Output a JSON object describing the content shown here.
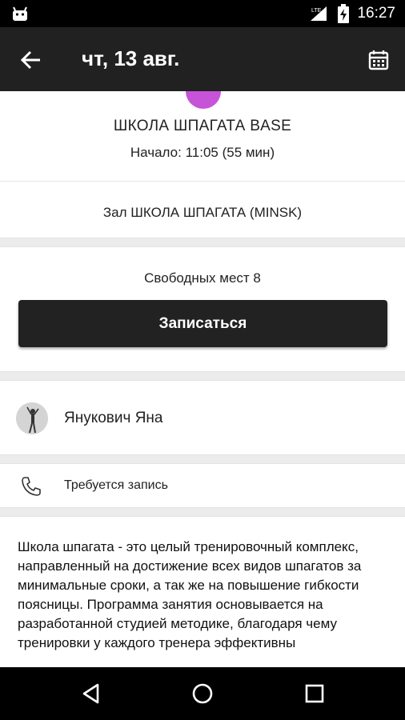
{
  "status_bar": {
    "time": "16:27",
    "network_label": "LTE",
    "icons": [
      "android-icon",
      "signal-icon",
      "battery-charging-icon"
    ]
  },
  "appbar": {
    "title": "чт, 13 авг.",
    "icons": [
      "back-arrow-icon",
      "calendar-icon"
    ]
  },
  "class": {
    "accent_color": "#c653d8",
    "title": "ШКОЛА ШПАГАТА BASE",
    "start": "Начало: 11:05 (55 мин)"
  },
  "hall": {
    "label": "Зал ШКОЛА ШПАГАТА (MINSK)"
  },
  "booking": {
    "free_seats": "Свободных мест 8",
    "signup_label": "Записаться"
  },
  "trainer": {
    "name": "Янукович Яна"
  },
  "requirement": {
    "icon": "phone-icon",
    "label": "Требуется запись"
  },
  "description": {
    "text": "Школа шпагата - это целый тренировочный комплекс, направленный на достижение всех видов шпагатов за минимальные сроки, а так же на повышение гибкости поясницы. Программа занятия основывается на разработанной студией методике, благодаря чему тренировки у каждого тренера эффективны"
  },
  "nav_bar": {
    "icons": [
      "back-triangle-icon",
      "home-circle-icon",
      "recents-square-icon"
    ]
  }
}
